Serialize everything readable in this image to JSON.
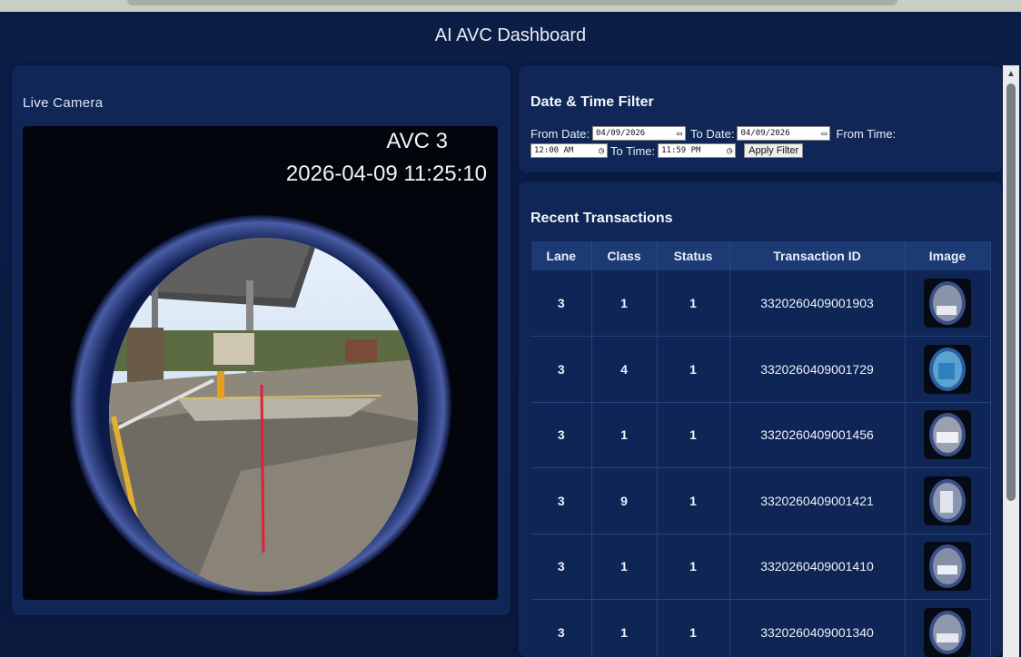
{
  "header": {
    "title": "AI AVC Dashboard"
  },
  "camera": {
    "title": "Live Camera",
    "overlay_label": "AVC 3",
    "overlay_timestamp": "2026-04-09 11:25:10"
  },
  "filter": {
    "title": "Date & Time Filter",
    "from_date_label": "From Date:",
    "from_date_value": "04/09/2026",
    "to_date_label": "To Date:",
    "to_date_value": "04/09/2026",
    "from_time_label": "From Time:",
    "from_time_value": "12:00 AM",
    "to_time_label": "To Time:",
    "to_time_value": "11:59 PM",
    "apply_label": "Apply Filter"
  },
  "transactions": {
    "title": "Recent Transactions",
    "columns": [
      "Lane",
      "Class",
      "Status",
      "Transaction ID",
      "Image"
    ],
    "rows": [
      {
        "lane": "3",
        "class": "1",
        "status": "1",
        "id": "3320260409001903"
      },
      {
        "lane": "3",
        "class": "4",
        "status": "1",
        "id": "3320260409001729"
      },
      {
        "lane": "3",
        "class": "1",
        "status": "1",
        "id": "3320260409001456"
      },
      {
        "lane": "3",
        "class": "9",
        "status": "1",
        "id": "3320260409001421"
      },
      {
        "lane": "3",
        "class": "1",
        "status": "1",
        "id": "3320260409001410"
      },
      {
        "lane": "3",
        "class": "1",
        "status": "1",
        "id": "3320260409001340"
      }
    ]
  },
  "icons": {
    "calendar": "calendar-icon",
    "clock": "clock-icon",
    "scroll_up": "scroll-up-arrow-icon"
  },
  "colors": {
    "background": "#0a1a3a",
    "panel": "#0f2656",
    "table_header": "#1c3a74"
  }
}
